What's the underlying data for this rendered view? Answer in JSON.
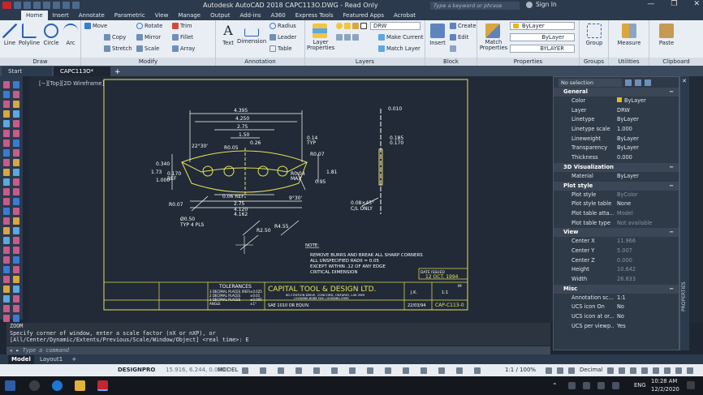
{
  "titlebar": {
    "title": "Autodesk AutoCAD 2018    CAPC113O.DWG - Read Only",
    "search_placeholder": "Type a keyword or phrase",
    "signin": "Sign In",
    "minimize": "—",
    "restore": "❐",
    "close": "✕"
  },
  "ribbon_tabs": [
    "Home",
    "Insert",
    "Annotate",
    "Parametric",
    "View",
    "Manage",
    "Output",
    "Add-ins",
    "A360",
    "Express Tools",
    "Featured Apps",
    "Acrobat"
  ],
  "ribbon": {
    "draw": {
      "label": "Draw",
      "line": "Line",
      "polyline": "Polyline",
      "circle": "Circle",
      "arc": "Arc"
    },
    "modify": {
      "label": "Modify",
      "move": "Move",
      "rotate": "Rotate",
      "trim": "Trim",
      "copy": "Copy",
      "mirror": "Mirror",
      "fillet": "Fillet",
      "stretch": "Stretch",
      "scale": "Scale",
      "array": "Array"
    },
    "annotation": {
      "label": "Annotation",
      "text": "Text",
      "dimension": "Dimension",
      "radius": "Radius",
      "leader": "Leader",
      "table": "Table"
    },
    "layers": {
      "label": "Layers",
      "layer_properties": "Layer Properties",
      "layer_value": "DRW",
      "make_current": "Make Current",
      "match_layer": "Match Layer"
    },
    "block": {
      "label": "Block",
      "insert": "Insert",
      "create": "Create",
      "edit": "Edit"
    },
    "properties": {
      "label": "Properties",
      "match_properties": "Match Properties",
      "color": "ByLayer",
      "linetype": "ByLayer",
      "lineweight": "BYLAYER"
    },
    "groups": {
      "label": "Groups",
      "group": "Group"
    },
    "utilities": {
      "label": "Utilities",
      "measure": "Measure"
    },
    "clipboard": {
      "label": "Clipboard",
      "paste": "Paste"
    }
  },
  "doc_tabs": [
    "Start",
    "CAPC113O*"
  ],
  "viewport_label": "[−][Top][2D Wireframe]",
  "drawing": {
    "dims": [
      "4.395",
      "4.250",
      "2.75",
      "1.50",
      "0.26",
      "R0.05",
      "0.14",
      "TYP",
      "22°30'",
      "R0.07",
      "0.340",
      "1.73",
      "0.170",
      "REF",
      "1.000",
      "1.81",
      "R0.04",
      "MAX",
      "0.95",
      "9°30'",
      "0.06 REF",
      "2.75",
      "4.120",
      "4.162",
      "R0.07",
      "Ø0.50",
      "TYP 4 PLS",
      "R2.50",
      "R4.55",
      "0.185",
      "0.170",
      "0.010",
      "0.08×45°",
      "C/L ONLY"
    ],
    "notes_title": "NOTE:",
    "notes": [
      "REMOVE BURRS AND BREAK ALL SHARP CORNERS",
      "ALL UNSPECIFIED RADII = 0.05",
      "EXCEPT WITHIN .12 OF ANY EDGE",
      "CRITICAL DIMENSION"
    ],
    "date_issued_label": "DATE ISSUED",
    "date_issued": "12 OCT. 1994",
    "company": "CAPITAL TOOL & DESIGN LTD.",
    "address": "60 CITATION DRIVE, CONCORD, ONTARIO, L4K 2W9",
    "phone": "(416)660-8088    FAX: (416)660-3995",
    "tolerances_label": "TOLERANCES",
    "tolerances": [
      [
        "3 DECIMAL PLACES (REF)",
        "±0.025"
      ],
      [
        "2 DECIMAL PLACES",
        "±0.01"
      ],
      [
        "3 DECIMAL PLACES",
        "±0.005"
      ],
      [
        "ANGLE",
        "±1°"
      ]
    ],
    "material": "SAE 1010 OR EQUIV.",
    "initials": "J.K.",
    "scale": "1:1",
    "date": "22/03/94",
    "drawing_no": "CAP-C113-0",
    "rev": "IM"
  },
  "properties": {
    "selection": "No selection",
    "sections": {
      "general": "General",
      "viz3d": "3D Visualization",
      "plot": "Plot style",
      "view": "View",
      "misc": "Misc"
    },
    "general": [
      [
        "Color",
        "ByLayer"
      ],
      [
        "Layer",
        "DRW"
      ],
      [
        "Linetype",
        "ByLayer"
      ],
      [
        "Linetype scale",
        "1.000"
      ],
      [
        "Lineweight",
        "ByLayer"
      ],
      [
        "Transparency",
        "ByLayer"
      ],
      [
        "Thickness",
        "0.000"
      ]
    ],
    "viz3d": [
      [
        "Material",
        "ByLayer"
      ]
    ],
    "plot": [
      [
        "Plot style",
        "ByColor"
      ],
      [
        "Plot style table",
        "None"
      ],
      [
        "Plot table atta...",
        "Model"
      ],
      [
        "Plot table type",
        "Not available"
      ]
    ],
    "view": [
      [
        "Center X",
        "11.966"
      ],
      [
        "Center Y",
        "5.007"
      ],
      [
        "Center Z",
        "0.000"
      ],
      [
        "Height",
        "10.642"
      ],
      [
        "Width",
        "26.833"
      ]
    ],
    "misc": [
      [
        "Annotation sc...",
        "1:1"
      ],
      [
        "UCS icon On",
        "No"
      ],
      [
        "UCS icon at or...",
        "No"
      ],
      [
        "UCS per viewp...",
        "Yes"
      ]
    ],
    "side_label": "PROPERTIES"
  },
  "command": {
    "history": [
      "ZOOM",
      "Specify corner of window, enter a scale factor (nX or nXP), or",
      "[All/Center/Dynamic/Extents/Previous/Scale/Window/Object] <real time>: E"
    ],
    "placeholder": "Type a command"
  },
  "layout_tabs": [
    "Model",
    "Layout1",
    "+"
  ],
  "statusbar": {
    "designpro": "DESIGNPRO",
    "coords": "15.916, 6.244, 0.000",
    "model": "MODEL",
    "scale": "1:1 / 100%",
    "units": "Decimal"
  },
  "taskbar": {
    "lang": "ENG",
    "time": "10:28 AM",
    "date": "12/2/2020"
  },
  "colors": {
    "accent": "#e9b817",
    "drawing_yellow": "#e8e25a",
    "drawing_white": "#ffffff",
    "viewport_bg": "#212a36"
  }
}
